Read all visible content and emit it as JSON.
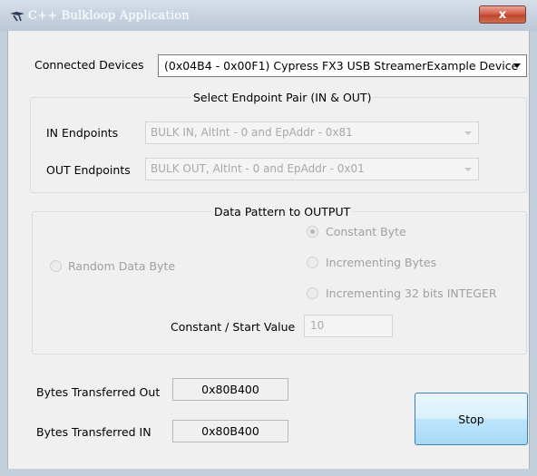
{
  "window": {
    "title": "C++ Bulkloop Application",
    "close_label": "x"
  },
  "device": {
    "label": "Connected Devices",
    "selected": "(0x04B4 - 0x00F1) Cypress FX3 USB StreamerExample Device"
  },
  "endpoints": {
    "group_title": "Select Endpoint Pair (IN & OUT)",
    "in_label": "IN Endpoints",
    "in_value": "BULK IN, AltInt - 0 and EpAddr - 0x81",
    "out_label": "OUT Endpoints",
    "out_value": "BULK OUT, AltInt - 0 and EpAddr - 0x01"
  },
  "pattern": {
    "group_title": "Data Pattern to OUTPUT",
    "random_label": "Random Data Byte",
    "constant_label": "Constant Byte",
    "incrementing_label": "Incrementing Bytes",
    "incrementing32_label": "Incrementing 32 bits INTEGER",
    "selected": "Constant Byte",
    "start_label": "Constant / Start Value",
    "start_value": "10"
  },
  "stats": {
    "out_label": "Bytes Transferred Out",
    "out_value": "0x80B400",
    "in_label": "Bytes Transferred IN",
    "in_value": "0x80B400"
  },
  "actions": {
    "stop_label": "Stop"
  },
  "colors": {
    "titlebar": "#c8d2df",
    "close": "#c0452e",
    "stop_button": "#bee6fd",
    "disabled_text": "#a0a0a0"
  }
}
